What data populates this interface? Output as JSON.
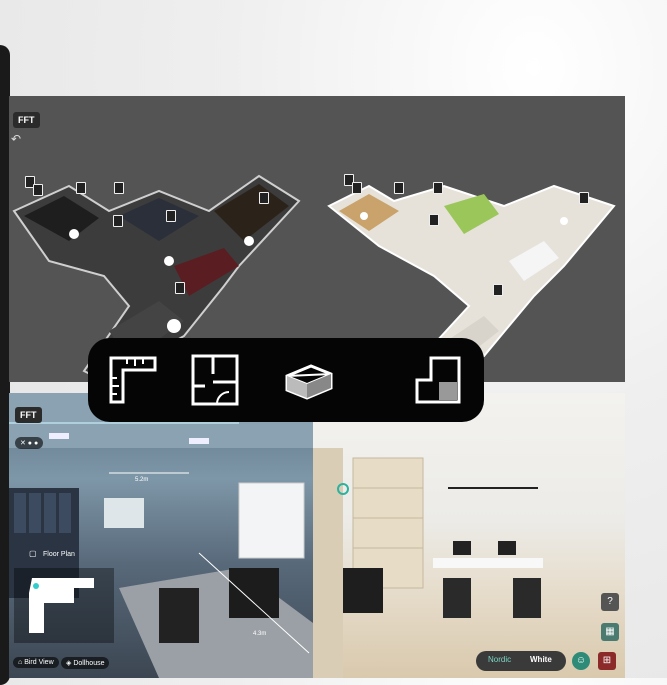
{
  "top_panel": {
    "badge": "FFT"
  },
  "bottom_left": {
    "badge": "FFT",
    "floor_plan_label": "Floor Plan",
    "measure_top": "5.2m",
    "measure_bottom": "4.3m",
    "bird_view_label": "Bird View",
    "dollhouse_label": "Dollhouse"
  },
  "bottom_right": {
    "toggle_left": "Nordic",
    "toggle_right": "White",
    "help_label": "?"
  },
  "toolbar": {
    "tools": [
      "measure-tool",
      "floor-plan-tool",
      "dollhouse-tool",
      "room-tool"
    ]
  }
}
